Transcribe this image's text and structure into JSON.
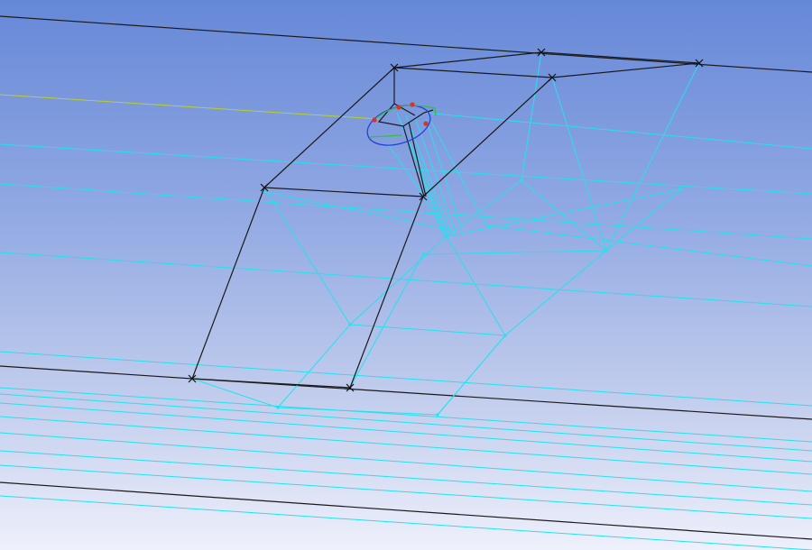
{
  "viewport": {
    "background_top": "#6688d8",
    "background_bottom": "#eef0fb"
  },
  "colors": {
    "cyan_edge": "#22e2ee",
    "black_edge": "#1a1a1a",
    "vertex_marker": "#111111",
    "construction_line": "#b8d030",
    "green_curve": "#30c040",
    "blue_curve": "#2a40d8",
    "selection_point": "#e03020"
  },
  "legend_icons": [
    "vertex-marker",
    "selection-point"
  ]
}
